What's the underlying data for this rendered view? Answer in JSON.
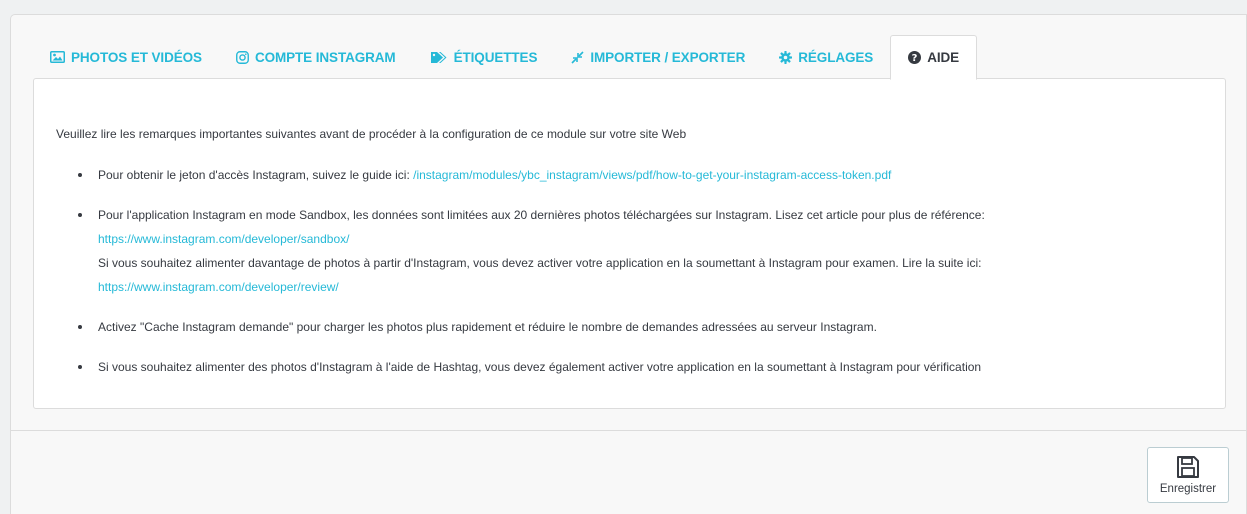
{
  "tabs": [
    {
      "label": "PHOTOS ET VIDÉOS",
      "icon": "image-icon",
      "active": false
    },
    {
      "label": "COMPTE INSTAGRAM",
      "icon": "instagram-icon",
      "active": false
    },
    {
      "label": "ÉTIQUETTES",
      "icon": "tags-icon",
      "active": false
    },
    {
      "label": "IMPORTER / EXPORTER",
      "icon": "compress-icon",
      "active": false
    },
    {
      "label": "RÉGLAGES",
      "icon": "cog-icon",
      "active": false
    },
    {
      "label": "AIDE",
      "icon": "question-circle-icon",
      "active": true
    }
  ],
  "help": {
    "intro": "Veuillez lire les remarques importantes suivantes avant de procéder à la configuration de ce module sur votre site Web",
    "note1": {
      "text": "Pour obtenir le jeton d'accès Instagram, suivez le guide ici: ",
      "link": "/instagram/modules/ybc_instagram/views/pdf/how-to-get-your-instagram-access-token.pdf"
    },
    "note2": {
      "text": "Pour l'application Instagram en mode Sandbox, les données sont limitées aux 20 dernières photos téléchargées sur Instagram. Lisez cet article pour plus de référence:",
      "link": "https://www.instagram.com/developer/sandbox/",
      "text2": "Si vous souhaitez alimenter davantage de photos à partir d'Instagram, vous devez activer votre application en la soumettant à Instagram pour examen. Lire la suite ici:",
      "link2": "https://www.instagram.com/developer/review/"
    },
    "note3": "Activez \"Cache Instagram demande\" pour charger les photos plus rapidement et réduire le nombre de demandes adressées au serveur Instagram.",
    "note4": "Si vous souhaitez alimenter des photos d'Instagram à l'aide de Hashtag, vous devez également activer votre application en la soumettant à Instagram pour vérification"
  },
  "footer": {
    "save_label": "Enregistrer",
    "save_icon": "floppy-disk-icon"
  },
  "colors": {
    "accent": "#25b9d7",
    "text": "#363a41",
    "border": "#dcdcdc"
  }
}
